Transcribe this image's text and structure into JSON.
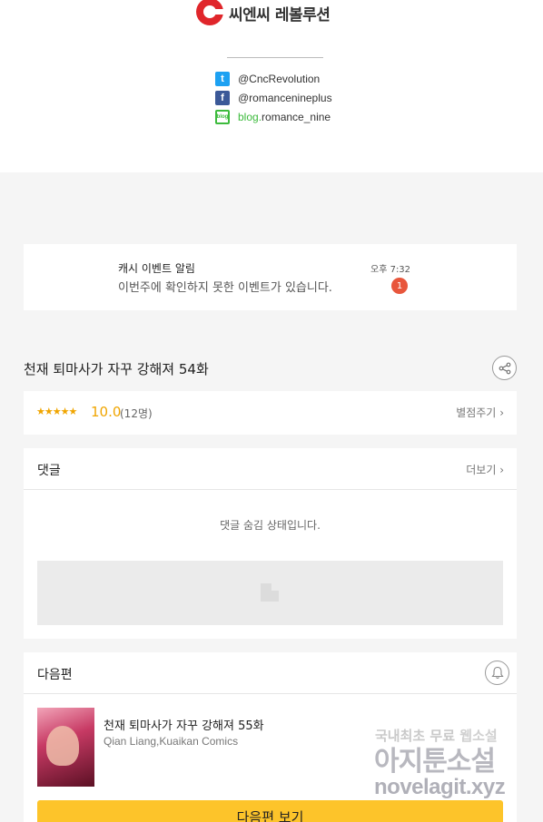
{
  "header": {
    "logo_text": "씨엔씨 레볼루션",
    "socials": [
      {
        "icon": "twitter-icon",
        "text": "@CncRevolution",
        "color": "#1da1f2"
      },
      {
        "icon": "facebook-icon",
        "text": "@romancenineplus",
        "color": "#3b5998"
      },
      {
        "icon": "blog-icon",
        "prefix": "blog.",
        "text": "romance_nine",
        "color": "#3dbb3d"
      }
    ]
  },
  "notification": {
    "title": "캐시 이벤트 알림",
    "body": "이번주에 확인하지 못한 이벤트가 있습니다.",
    "time": "오후 7:32",
    "badge": "1"
  },
  "episode": {
    "title": "천재 퇴마사가 자꾸 강해져 54화"
  },
  "rating": {
    "stars": "★★★★★",
    "score": "10.0",
    "count": "(12명)",
    "action": "별점주기"
  },
  "comments": {
    "title": "댓글",
    "more": "더보기",
    "hidden_message": "댓글 숨김 상태입니다."
  },
  "next_episode": {
    "section_title": "다음편",
    "title": "천재 퇴마사가 자꾸 강해져 55화",
    "authors": "Qian Liang,Kuaikan Comics",
    "button": "다음편 보기"
  },
  "watermark": {
    "line1_a": "국내최초 무료",
    "line1_b": "웹소설",
    "line2": "아지툰소설",
    "line3": "novelagit.xyz"
  },
  "colors": {
    "accent": "#fdc42a",
    "rating": "#f0a500",
    "badge": "#e8563c",
    "brand": "#e0262b"
  }
}
